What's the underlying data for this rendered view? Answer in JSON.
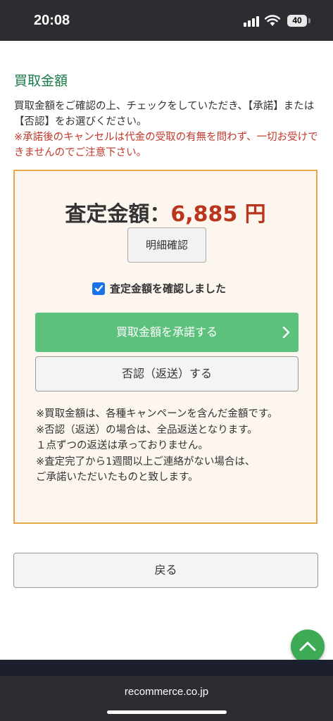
{
  "status": {
    "time": "20:08",
    "battery": "40"
  },
  "section_title": "買取金額",
  "intro": {
    "text": "買取金額をご確認の上、チェックをしていただき、【承諾】または【否認】をお選びください。",
    "warning": "※承諾後のキャンセルは代金の受取の有無を問わず、一切お受けできませんのでご注意下さい。"
  },
  "assessment": {
    "label": "査定金額：",
    "amount": "6,885 円",
    "detail_button": "明細確認",
    "checkbox_label": "査定金額を確認しました",
    "checkbox_checked": true,
    "accept_button": "買取金額を承諾する",
    "reject_button": "否認（返送）する",
    "notes": [
      "※買取金額は、各種キャンペーンを含んだ金額です。",
      "※否認（返送）の場合は、全品返送となります。",
      "１点ずつの返送は承っておりません。",
      "※査定完了から1週間以上ご連絡がない場合は、",
      "ご承諾いただいたものと致します。"
    ]
  },
  "back_button": "戻る",
  "browser": {
    "url": "recommerce.co.jp"
  },
  "colors": {
    "accent_green": "#5cc17c",
    "title_green": "#1a7a4a",
    "warning_red": "#c0392b",
    "amount_red": "#b8361d",
    "panel_border": "#e6a84a"
  },
  "icons": [
    "signal-icon",
    "wifi-icon",
    "battery-icon",
    "checkbox-icon",
    "chevron-right-icon",
    "chevron-up-icon"
  ]
}
